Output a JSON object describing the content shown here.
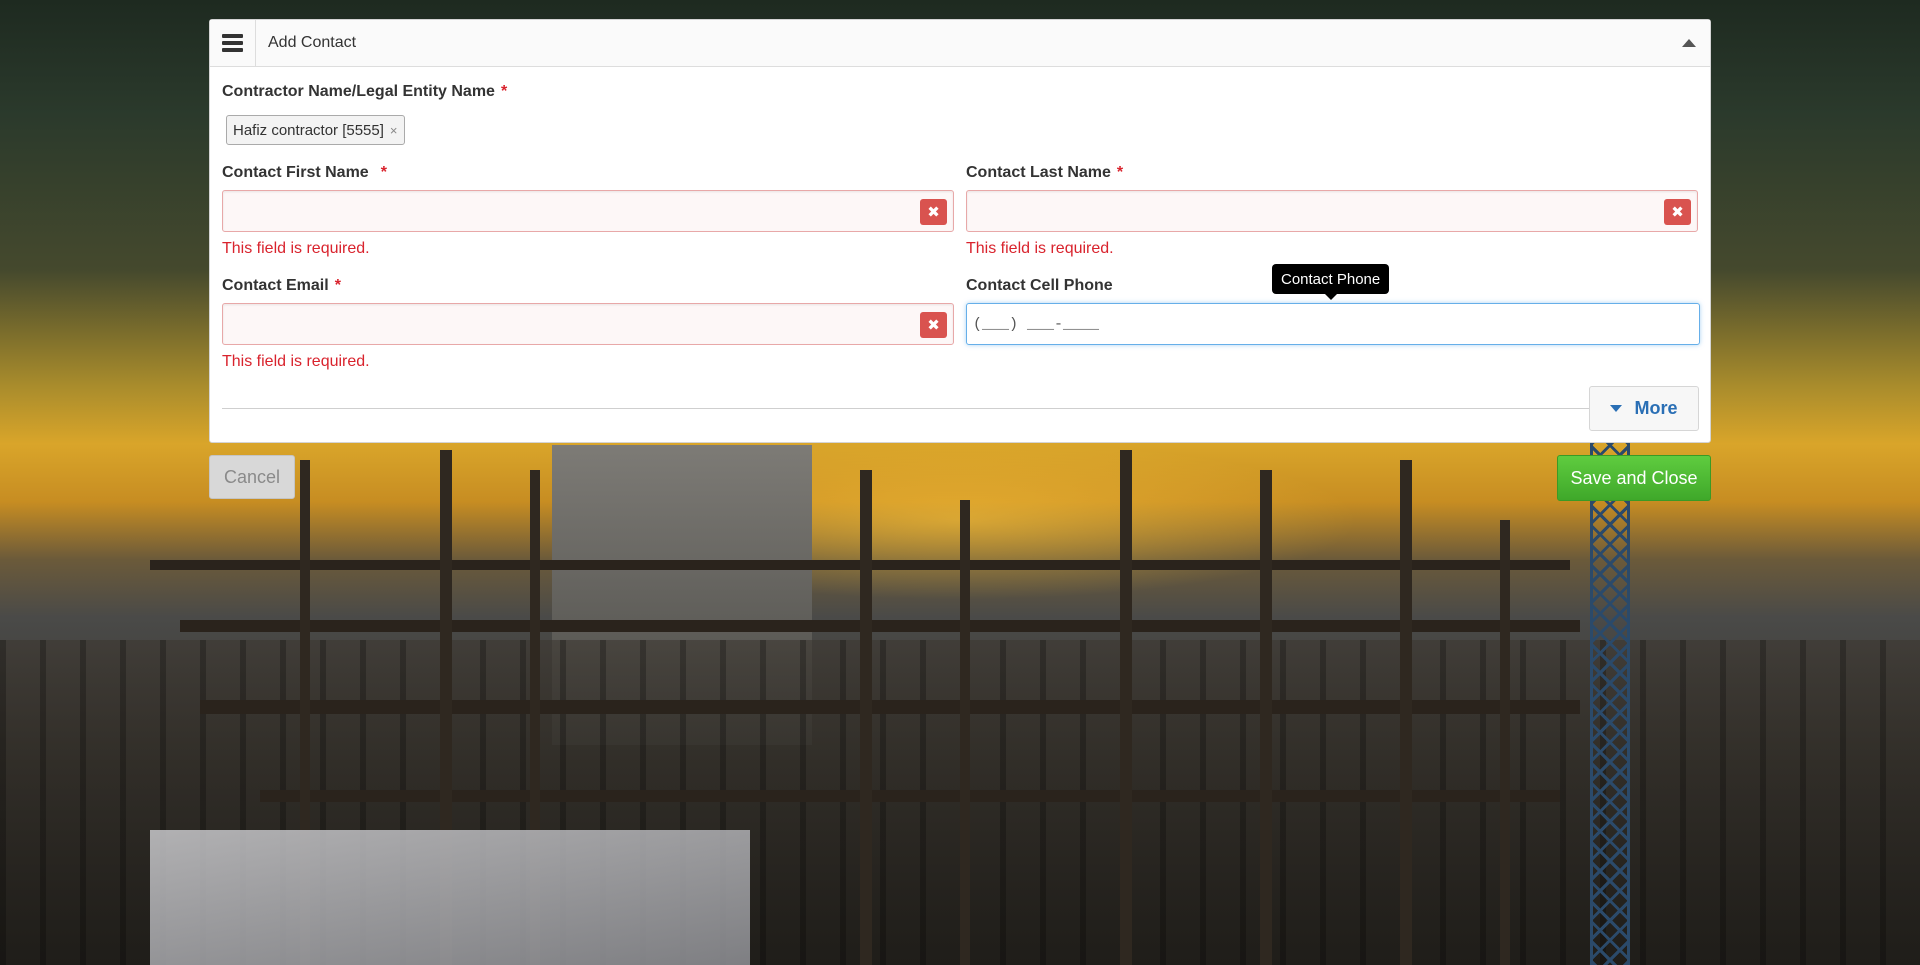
{
  "panel": {
    "title": "Add Contact"
  },
  "contractor": {
    "label": "Contractor Name/Legal Entity Name",
    "required_mark": "*",
    "tag": "Hafiz contractor [5555]",
    "tag_remove": "×"
  },
  "first_name": {
    "label": "Contact First Name",
    "required_mark": "*",
    "value": "",
    "error": "This field is required.",
    "clear": "✖"
  },
  "last_name": {
    "label": "Contact Last Name",
    "required_mark": "*",
    "value": "",
    "error": "This field is required.",
    "clear": "✖"
  },
  "email": {
    "label": "Contact Email",
    "required_mark": "*",
    "value": "",
    "error": "This field is required.",
    "clear": "✖"
  },
  "cell_phone": {
    "label": "Contact Cell Phone",
    "value": "(___) ___-____",
    "tooltip": "Contact Phone"
  },
  "more_button": {
    "label": "More"
  },
  "actions": {
    "cancel": "Cancel",
    "save_close": "Save and Close"
  },
  "colors": {
    "required": "#d9232d",
    "danger": "#d9534f",
    "link_blue": "#2a6fb5",
    "success": "#4cb832"
  },
  "icons": {
    "menu": "hamburger-menu-icon",
    "collapse": "caret-up-icon",
    "more": "caret-down-icon",
    "clear": "close-icon"
  }
}
